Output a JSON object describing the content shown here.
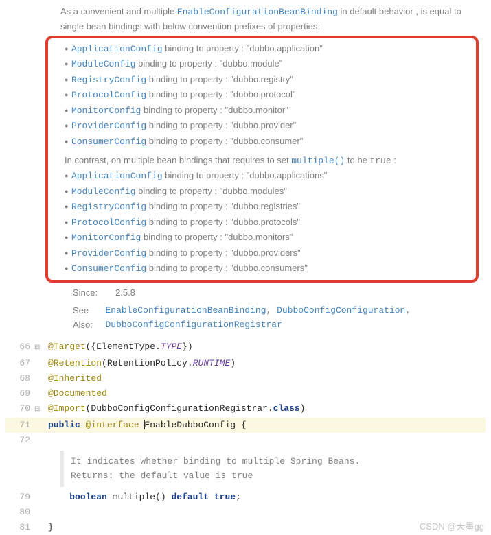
{
  "doc": {
    "intro_before": "As a convenient and multiple ",
    "intro_link": "EnableConfigurationBeanBinding",
    "intro_after": " in default behavior , is equal to single bean bindings with below convention prefixes of properties:",
    "single_bindings": [
      {
        "cls": "ApplicationConfig",
        "text": " binding to property : \"dubbo.application\""
      },
      {
        "cls": "ModuleConfig",
        "text": " binding to property : \"dubbo.module\""
      },
      {
        "cls": "RegistryConfig",
        "text": " binding to property : \"dubbo.registry\""
      },
      {
        "cls": "ProtocolConfig",
        "text": " binding to property : \"dubbo.protocol\""
      },
      {
        "cls": "MonitorConfig",
        "text": " binding to property : \"dubbo.monitor\""
      },
      {
        "cls": "ProviderConfig",
        "text": " binding to property : \"dubbo.provider\""
      },
      {
        "cls": "ConsumerConfig",
        "text": " binding to property : \"dubbo.consumer\""
      }
    ],
    "contrast_before": "In contrast, on multiple bean bindings that requires to set ",
    "contrast_link": "multiple()",
    "contrast_mid": " to be ",
    "contrast_code": "true",
    "contrast_after": " :",
    "multiple_bindings": [
      {
        "cls": "ApplicationConfig",
        "text": " binding to property : \"dubbo.applications\""
      },
      {
        "cls": "ModuleConfig",
        "text": " binding to property : \"dubbo.modules\""
      },
      {
        "cls": "RegistryConfig",
        "text": " binding to property : \"dubbo.registries\""
      },
      {
        "cls": "ProtocolConfig",
        "text": " binding to property : \"dubbo.protocols\""
      },
      {
        "cls": "MonitorConfig",
        "text": " binding to property : \"dubbo.monitors\""
      },
      {
        "cls": "ProviderConfig",
        "text": " binding to property : \"dubbo.providers\""
      },
      {
        "cls": "ConsumerConfig",
        "text": " binding to property : \"dubbo.consumers\""
      }
    ],
    "since_label": "Since:",
    "since_value": "2.5.8",
    "see_also_label": "See Also:",
    "see_also_links": [
      "EnableConfigurationBeanBinding",
      "DubboConfigConfiguration",
      "DubboConfigConfigurationRegistrar"
    ],
    "see_also_sep": ", "
  },
  "code": {
    "lines": {
      "66": {
        "ann": "@Target",
        "plain1": "({ElementType.",
        "type": "TYPE",
        "plain2": "})"
      },
      "67": {
        "ann": "@Retention",
        "plain1": "(RetentionPolicy.",
        "type": "RUNTIME",
        "plain2": ")"
      },
      "68": {
        "ann": "@Inherited"
      },
      "69": {
        "ann": "@Documented"
      },
      "70": {
        "ann": "@Import",
        "plain1": "(DubboConfigConfigurationRegistrar.",
        "kw": "class",
        "plain2": ")"
      },
      "71": {
        "kw1": "public ",
        "ann": "@interface ",
        "cls": "EnableDubboConfig",
        "plain": " {"
      },
      "72": {
        "plain": ""
      },
      "79": {
        "kw1": "boolean ",
        "name": "multiple",
        "plain1": "() ",
        "kw2": "default true",
        "plain2": ";"
      },
      "80": {
        "plain": ""
      },
      "81": {
        "plain": "}"
      }
    },
    "inner_doc": {
      "line1": "It indicates whether binding to multiple Spring Beans.",
      "returns_label": "Returns:",
      "returns_text": " the default value is ",
      "returns_code": "true"
    }
  },
  "line_numbers": {
    "l66": "66",
    "l67": "67",
    "l68": "68",
    "l69": "69",
    "l70": "70",
    "l71": "71",
    "l72": "72",
    "l79": "79",
    "l80": "80",
    "l81": "81"
  },
  "watermark": "CSDN @天墨gg"
}
